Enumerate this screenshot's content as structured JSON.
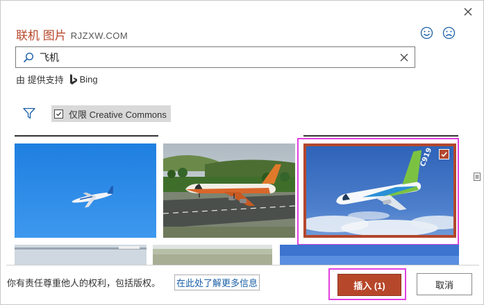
{
  "dialog": {
    "title": "联机 图片",
    "watermark": "RJZXW.COM",
    "close_icon": "close-icon",
    "feedback": {
      "smile_icon": "smile-icon",
      "frown_icon": "frown-icon"
    }
  },
  "search": {
    "value": "飞机",
    "search_icon": "search-icon",
    "clear_icon": "close-icon"
  },
  "powered_by": {
    "prefix": "由 提供支持",
    "provider": "Bing"
  },
  "filters": {
    "filter_icon": "funnel-icon",
    "creative_commons": {
      "label": "仅限 Creative Commons",
      "checked": true
    }
  },
  "results": {
    "thumbnails": [
      {
        "id": 1,
        "selected": false
      },
      {
        "id": 2,
        "selected": false
      },
      {
        "id": 3,
        "selected": true,
        "tail_text": "C919"
      },
      {
        "id": 4,
        "selected": false
      },
      {
        "id": 5,
        "selected": false
      },
      {
        "id": 6,
        "selected": false
      }
    ]
  },
  "footer": {
    "rights_text": "你有责任尊重他人的权利，包括版权。",
    "learn_more": "在此处了解更多信息",
    "insert_label": "插入 (1)",
    "cancel_label": "取消"
  },
  "colors": {
    "accent": "#b7472a",
    "highlight": "#e040e0",
    "link": "#1a5fa8"
  }
}
